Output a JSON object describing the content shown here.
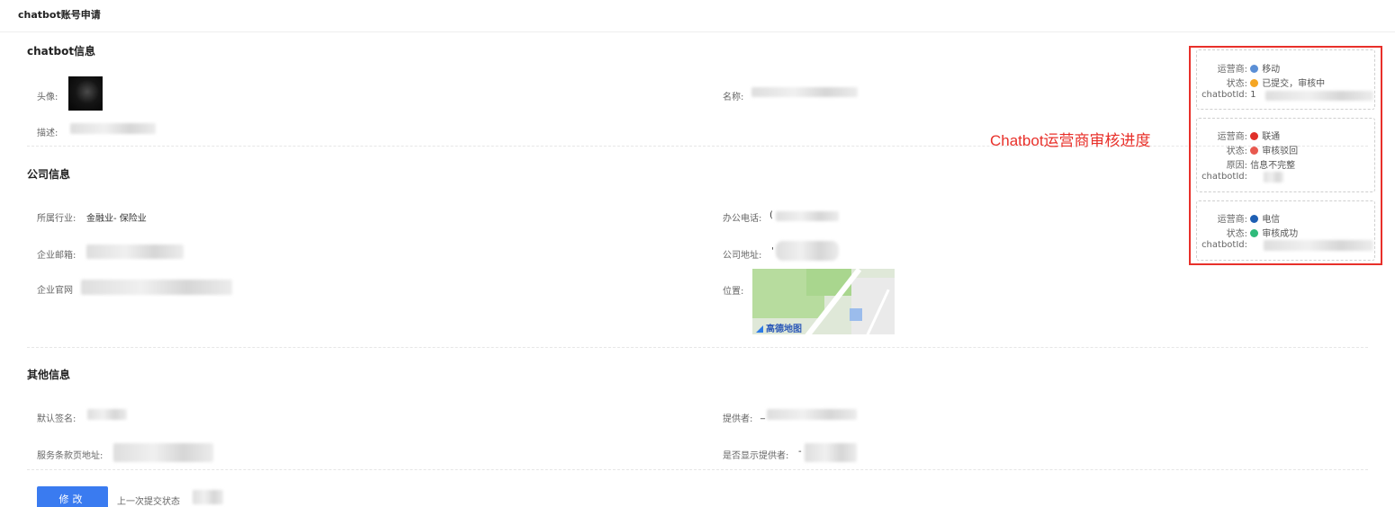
{
  "page": {
    "title": "chatbot账号申请"
  },
  "chatbot_section": {
    "title": "chatbot信息",
    "avatar_label": "头像:",
    "name_label": "名称:",
    "desc_label": "描述:"
  },
  "company_section": {
    "title": "公司信息",
    "industry_label": "所属行业:",
    "industry_value": "金融业- 保险业",
    "phone_label": "办公电话:",
    "phone_value_prefix": "(",
    "email_label": "企业邮箱:",
    "address_label": "公司地址:",
    "address_value_prefix": "'",
    "website_label": "企业官网",
    "location_label": "位置:",
    "map_logo": "高德地图"
  },
  "other_section": {
    "title": "其他信息",
    "signature_label": "默认签名:",
    "provider_label": "提供者:",
    "provider_value_prefix": "_",
    "terms_label": "服务条款页地址:",
    "show_provider_label": "是否显示提供者:",
    "show_provider_value_prefix": "-"
  },
  "operators": [
    {
      "carrier_label": "运营商:",
      "carrier": "移动",
      "carrier_icon": "china-mobile-icon",
      "carrier_color": "#5b8fd6",
      "status_label": "状态:",
      "status": "已提交，审核中",
      "status_icon": "pending-icon",
      "status_color": "#f5a623",
      "id_label": "chatbotId:",
      "id_prefix": "1"
    },
    {
      "carrier_label": "运营商:",
      "carrier": "联通",
      "carrier_icon": "china-unicom-icon",
      "carrier_color": "#e0302a",
      "status_label": "状态:",
      "status": "审核驳回",
      "status_icon": "rejected-icon",
      "status_color": "#e8594f",
      "reason_label": "原因:",
      "reason": "信息不完整",
      "id_label": "chatbotId:"
    },
    {
      "carrier_label": "运营商:",
      "carrier": "电信",
      "carrier_icon": "china-telecom-icon",
      "carrier_color": "#1e5fb3",
      "status_label": "状态:",
      "status": "审核成功",
      "status_icon": "success-icon",
      "status_color": "#2fba7a",
      "id_label": "chatbotId:"
    }
  ],
  "annotation": "Chatbot运营商审核进度",
  "footer": {
    "edit_button": "修改",
    "prev_status_label": "上一次提交状态"
  }
}
